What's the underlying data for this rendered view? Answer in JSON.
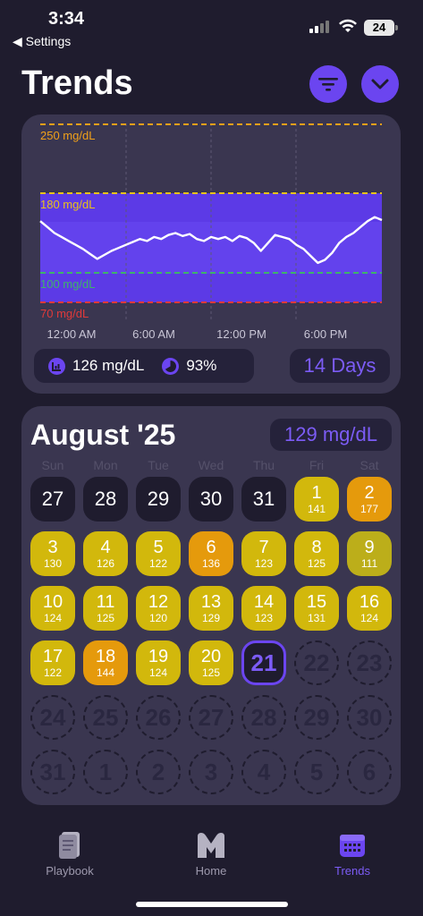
{
  "status": {
    "time": "3:34",
    "back_label": "◀ Settings",
    "battery": "24"
  },
  "header": {
    "title": "Trends",
    "filter_icon": "filter-icon",
    "collapse_icon": "chevron-down-icon"
  },
  "chart": {
    "y_thresholds": [
      {
        "label": "250 mg/dL",
        "color": "#f0a01a"
      },
      {
        "label": "180 mg/dL",
        "color": "#e8c21a"
      },
      {
        "label": "100 mg/dL",
        "color": "#3fb36a"
      },
      {
        "label": "70 mg/dL",
        "color": "#e03a3a"
      }
    ],
    "x_labels": [
      "12:00 AM",
      "6:00 AM",
      "12:00 PM",
      "6:00 PM"
    ],
    "band_color": "#5c3ae6"
  },
  "chart_data": {
    "type": "line",
    "title": "",
    "xlabel": "",
    "ylabel": "",
    "x_ticks": [
      "12:00 AM",
      "6:00 AM",
      "12:00 PM",
      "6:00 PM"
    ],
    "thresholds": [
      250,
      180,
      100,
      70
    ],
    "threshold_labels": [
      "250 mg/dL",
      "180 mg/dL",
      "100 mg/dL",
      "70 mg/dL"
    ],
    "x_hours": [
      0,
      0.5,
      1,
      1.5,
      2,
      2.5,
      3,
      3.5,
      4,
      4.5,
      5,
      5.5,
      6,
      6.5,
      7,
      7.5,
      8,
      8.5,
      9,
      9.5,
      10,
      10.5,
      11,
      11.5,
      12,
      12.5,
      13,
      13.5,
      14,
      14.5,
      15,
      15.5,
      16,
      16.5,
      17,
      17.5,
      18,
      18.5,
      19,
      19.5,
      20,
      20.5,
      21,
      21.5,
      22,
      22.5,
      23,
      23.5,
      24
    ],
    "series": [
      {
        "values": [
          152,
          146,
          140,
          136,
          132,
          128,
          124,
          119,
          114,
          118,
          122,
          125,
          128,
          131,
          134,
          132,
          136,
          134,
          138,
          140,
          137,
          139,
          134,
          132,
          136,
          134,
          136,
          132,
          137,
          135,
          130,
          122,
          130,
          138,
          136,
          134,
          128,
          124,
          117,
          110,
          113,
          120,
          130,
          136,
          140,
          146,
          152,
          156,
          153
        ]
      }
    ]
  },
  "stats": {
    "average": "126 mg/dL",
    "in_range": "93%",
    "period": "14 Days"
  },
  "calendar": {
    "month": "August '25",
    "average": "129 mg/dL",
    "weekdays": [
      "Sun",
      "Mon",
      "Tue",
      "Wed",
      "Thu",
      "Fri",
      "Sat"
    ],
    "days": [
      {
        "num": "27",
        "val": "",
        "style": "dark"
      },
      {
        "num": "28",
        "val": "",
        "style": "dark"
      },
      {
        "num": "29",
        "val": "",
        "style": "dark"
      },
      {
        "num": "30",
        "val": "",
        "style": "dark"
      },
      {
        "num": "31",
        "val": "",
        "style": "dark"
      },
      {
        "num": "1",
        "val": "141",
        "style": "y1"
      },
      {
        "num": "2",
        "val": "177",
        "style": "y2"
      },
      {
        "num": "3",
        "val": "130",
        "style": "y1"
      },
      {
        "num": "4",
        "val": "126",
        "style": "y1"
      },
      {
        "num": "5",
        "val": "122",
        "style": "y1"
      },
      {
        "num": "6",
        "val": "136",
        "style": "y2"
      },
      {
        "num": "7",
        "val": "123",
        "style": "y1"
      },
      {
        "num": "8",
        "val": "125",
        "style": "y1"
      },
      {
        "num": "9",
        "val": "111",
        "style": "y3"
      },
      {
        "num": "10",
        "val": "124",
        "style": "y1"
      },
      {
        "num": "11",
        "val": "125",
        "style": "y1"
      },
      {
        "num": "12",
        "val": "120",
        "style": "y1"
      },
      {
        "num": "13",
        "val": "129",
        "style": "y1"
      },
      {
        "num": "14",
        "val": "123",
        "style": "y1"
      },
      {
        "num": "15",
        "val": "131",
        "style": "y1"
      },
      {
        "num": "16",
        "val": "124",
        "style": "y1"
      },
      {
        "num": "17",
        "val": "122",
        "style": "y1"
      },
      {
        "num": "18",
        "val": "144",
        "style": "y2"
      },
      {
        "num": "19",
        "val": "124",
        "style": "y1"
      },
      {
        "num": "20",
        "val": "125",
        "style": "y1"
      },
      {
        "num": "21",
        "val": "",
        "style": "today"
      },
      {
        "num": "22",
        "val": "",
        "style": "future"
      },
      {
        "num": "23",
        "val": "",
        "style": "future"
      },
      {
        "num": "24",
        "val": "",
        "style": "future"
      },
      {
        "num": "25",
        "val": "",
        "style": "future"
      },
      {
        "num": "26",
        "val": "",
        "style": "future"
      },
      {
        "num": "27",
        "val": "",
        "style": "future"
      },
      {
        "num": "28",
        "val": "",
        "style": "future"
      },
      {
        "num": "29",
        "val": "",
        "style": "future"
      },
      {
        "num": "30",
        "val": "",
        "style": "future"
      },
      {
        "num": "31",
        "val": "",
        "style": "future"
      },
      {
        "num": "1",
        "val": "",
        "style": "future"
      },
      {
        "num": "2",
        "val": "",
        "style": "future"
      },
      {
        "num": "3",
        "val": "",
        "style": "future"
      },
      {
        "num": "4",
        "val": "",
        "style": "future"
      },
      {
        "num": "5",
        "val": "",
        "style": "future"
      },
      {
        "num": "6",
        "val": "",
        "style": "future"
      }
    ]
  },
  "tabbar": [
    {
      "label": "Playbook",
      "icon": "book-icon",
      "active": false
    },
    {
      "label": "Home",
      "icon": "m-logo-icon",
      "active": false
    },
    {
      "label": "Trends",
      "icon": "calendar-icon",
      "active": true
    }
  ]
}
